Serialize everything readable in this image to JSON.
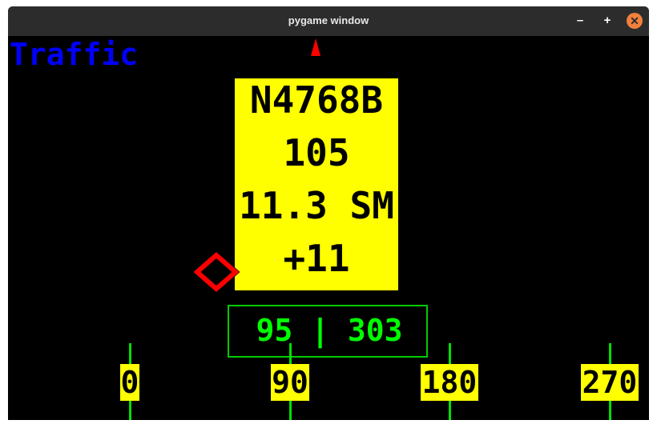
{
  "window": {
    "title": "pygame window",
    "controls": {
      "minimize": "–",
      "maximize": "+",
      "close": "✕"
    }
  },
  "display": {
    "label": "Traffic",
    "label_color": "#0000ff",
    "ownship_icon": "red-triangle-icon",
    "traffic": {
      "callsign": "N4768B",
      "bearing": "105",
      "distance": "11.3 SM",
      "altitude": "+11",
      "icon": "red-diamond-icon",
      "box_color": "#ffff00"
    },
    "heading_readout": "95 | 303",
    "heading_color": "#00ff00",
    "compass": {
      "ticks": [
        {
          "label": "0"
        },
        {
          "label": "90"
        },
        {
          "label": "180"
        },
        {
          "label": "270"
        }
      ]
    }
  }
}
